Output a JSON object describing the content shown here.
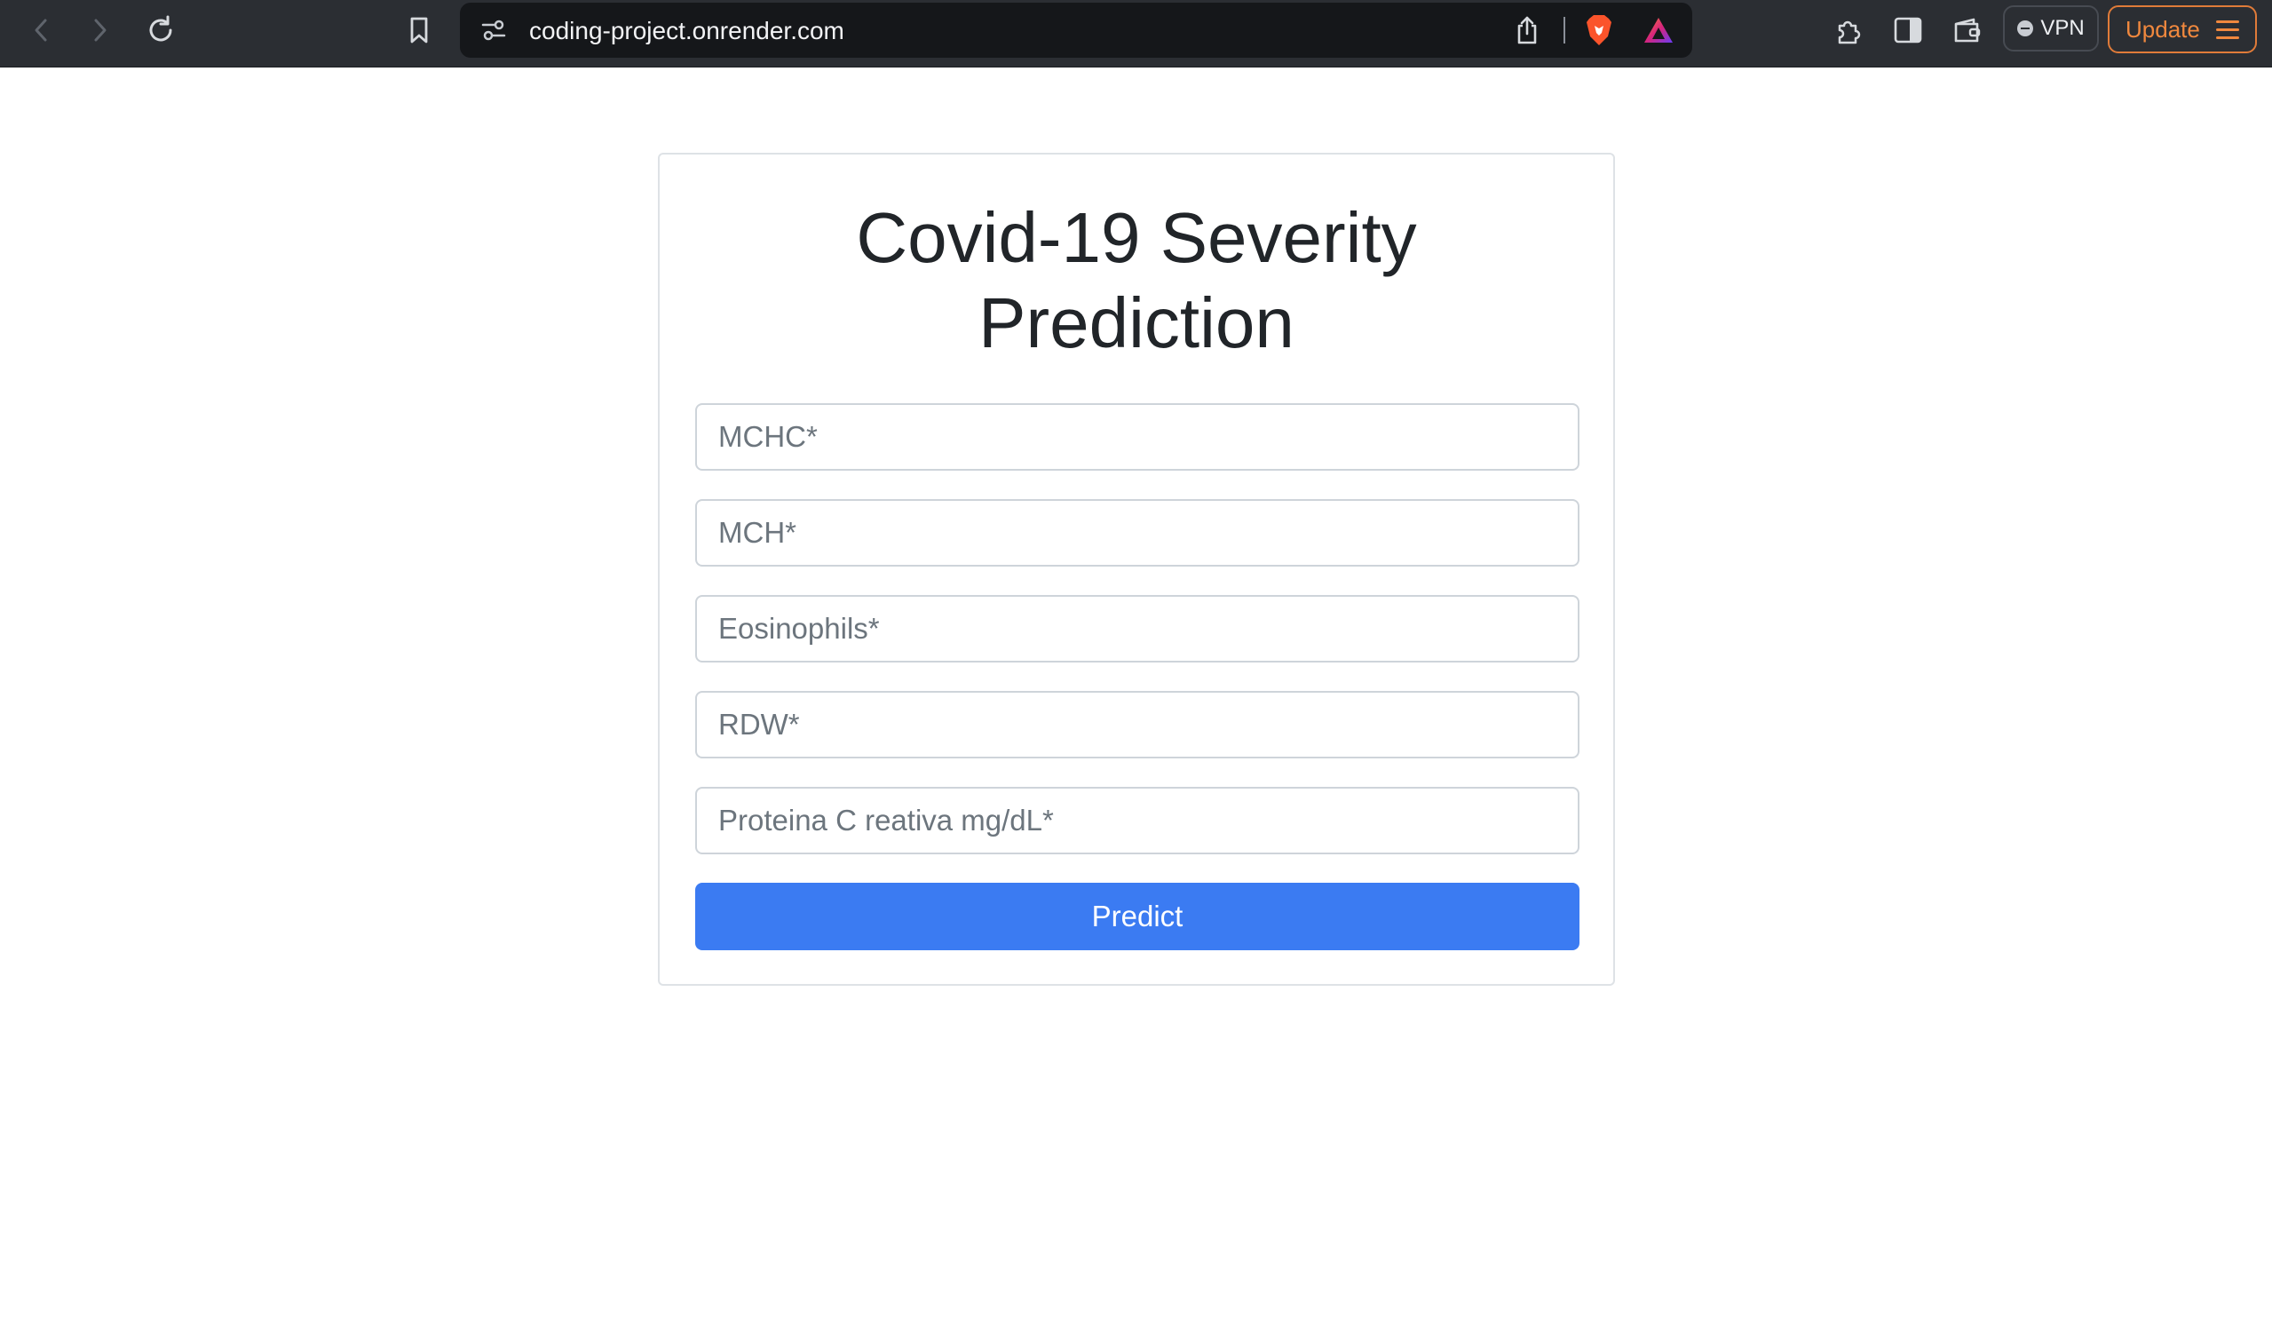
{
  "browser": {
    "url": "coding-project.onrender.com",
    "vpn_label": "VPN",
    "update_label": "Update",
    "icons": {
      "back": "back-arrow-icon",
      "forward": "forward-arrow-icon",
      "reload": "reload-icon",
      "bookmark": "bookmark-icon",
      "site_settings": "site-settings-icon",
      "share": "share-icon",
      "brave_shields": "brave-shields-icon",
      "brave_rewards": "brave-rewards-icon",
      "extensions": "extensions-icon",
      "sidebar": "sidebar-icon",
      "wallet": "wallet-icon",
      "menu": "hamburger-menu-icon"
    },
    "colors": {
      "toolbar": "#2b2e33",
      "update_accent": "#f0883e"
    }
  },
  "page": {
    "title_line1": "Covid-19 Severity",
    "title_line2": "Prediction",
    "form": {
      "fields": [
        {
          "name": "mchc",
          "placeholder": "MCHC*",
          "value": ""
        },
        {
          "name": "mch",
          "placeholder": "MCH*",
          "value": ""
        },
        {
          "name": "eosinophils",
          "placeholder": "Eosinophils*",
          "value": ""
        },
        {
          "name": "rdw",
          "placeholder": "RDW*",
          "value": ""
        },
        {
          "name": "proteina",
          "placeholder": "Proteina C reativa mg/dL*",
          "value": ""
        }
      ],
      "submit_label": "Predict"
    },
    "colors": {
      "button": "#3b7bf2",
      "title": "#212529",
      "border": "#dee2e6"
    }
  }
}
